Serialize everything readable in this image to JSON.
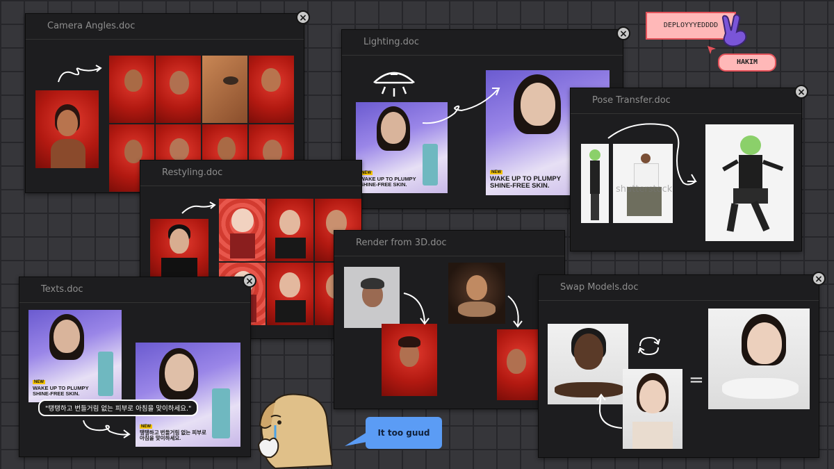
{
  "windows": {
    "camera_angles": {
      "title": "Camera Angles.doc"
    },
    "lighting": {
      "title": "Lighting.doc"
    },
    "pose_transfer": {
      "title": "Pose Transfer.doc",
      "watermark": "shutterstock"
    },
    "restyling": {
      "title": "Restyling.doc"
    },
    "render_3d": {
      "title": "Render from 3D.doc"
    },
    "texts": {
      "title": "Texts.doc",
      "caption": "\"탱탱하고 번들거림 없는 피부로 아침을 맞이하세요.\"",
      "translated_ad_line1": "탱탱하고 번들거림 없는 피부로",
      "translated_ad_line2": "아침을 맞이하세요."
    },
    "swap_models": {
      "title": "Swap Models.doc",
      "equals": "="
    }
  },
  "ad": {
    "badge": "NEW",
    "line1": "WAKE UP TO PLUMPY",
    "line2": "SHINE-FREE SKIN."
  },
  "stickers": {
    "deploy_label": "DEPLOYYYEDDDD",
    "hakim_label": "HAKIM",
    "speech_bubble": "It too guud"
  },
  "icons": {
    "close": "close-icon",
    "peace_hand": "peace-hand-icon",
    "cursor": "cursor-arrow-icon",
    "dog": "crying-dog-sticker",
    "light": "light-sketch-icon",
    "swap": "swap-cycle-icon"
  },
  "colors": {
    "background": "#36363a",
    "window": "#1d1d1f",
    "pink_label": "#ffb8b8",
    "speech_blue": "#5b9cf5"
  },
  "close_glyph": "×"
}
